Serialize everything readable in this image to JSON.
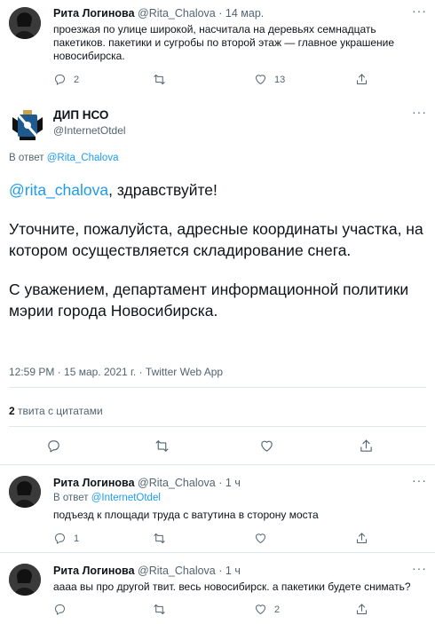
{
  "tweet1": {
    "name": "Рита Логинова",
    "handle": "@Rita_Chalova",
    "sep": "·",
    "time": "14 мар.",
    "text": "проезжая по улице широкой, насчитала на деревьях семнадцать пакетиков. пакетики и сугробы по второй этаж — главное украшение новосибирска.",
    "replies": "2",
    "retweets": "",
    "likes": "13",
    "more": "···"
  },
  "main": {
    "name": "ДИП НСО",
    "handle": "@InternetOtdel",
    "reply_prefix": "В ответ",
    "reply_link": "@Rita_Chalova",
    "greeting_link": "@rita_chalova",
    "greeting_rest": ", здравствуйте!",
    "paragraph2": "Уточните, пожалуйста, адресные координаты участка, на котором осуществляется складирование снега.",
    "paragraph3": "С уважением, департамент информационной политики мэрии города Новосибирска.",
    "meta": "12:59 PM · 15 мар. 2021 г. · Twitter Web App",
    "quote_count": "2",
    "quote_label": "твита с цитатами",
    "more": "···"
  },
  "reply1": {
    "name": "Рита Логинова",
    "handle": "@Rita_Chalova",
    "sep": "·",
    "time": "1 ч",
    "reply_prefix": "В ответ",
    "reply_link": "@InternetOtdel",
    "text": "подъезд к площади труда с ватутина в сторону моста",
    "replies": "1",
    "likes": "",
    "more": "···"
  },
  "reply2": {
    "name": "Рита Логинова",
    "handle": "@Rita_Chalova",
    "sep": "·",
    "time": "1 ч",
    "text": "аааа вы про другой твит. весь новосибирск. а пакетики будете снимать?",
    "replies": "",
    "likes": "2",
    "more": "···"
  },
  "colors": {
    "link": "#1d9bf0",
    "secondary": "#536471",
    "divider": "#e1e8ed"
  }
}
